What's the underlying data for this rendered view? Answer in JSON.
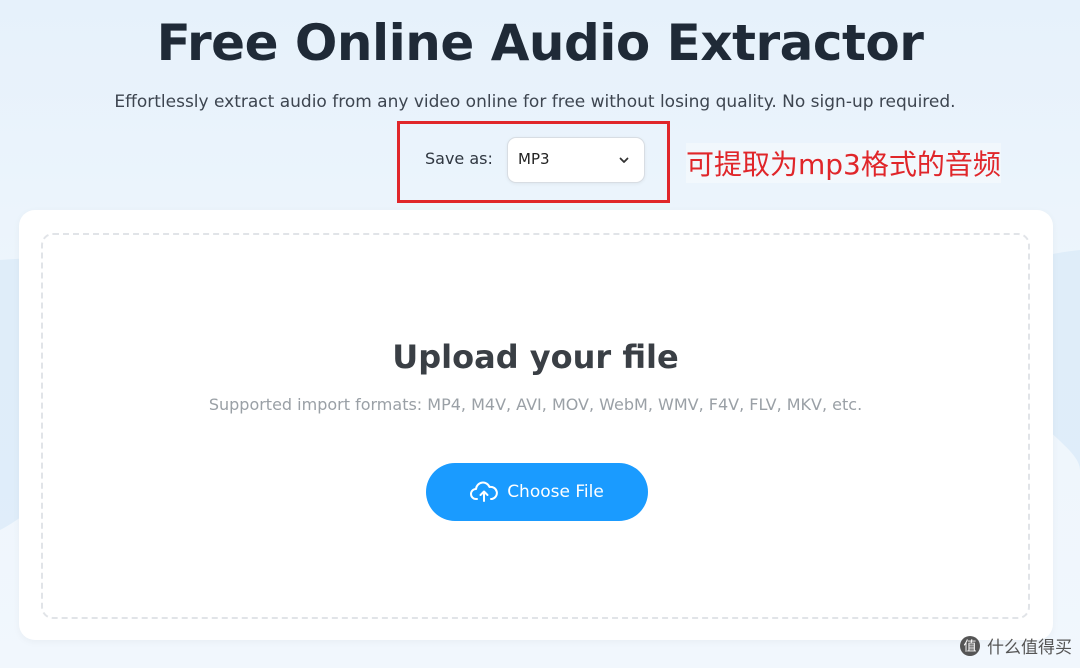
{
  "page": {
    "title": "Free Online Audio Extractor",
    "subtitle": "Effortlessly extract audio from any video online for free without losing quality. No sign-up required."
  },
  "save_as": {
    "label": "Save as:",
    "selected": "MP3"
  },
  "annotation": {
    "text": "可提取为mp3格式的音频",
    "color": "#e0262a"
  },
  "upload": {
    "title": "Upload your file",
    "formats": "Supported import formats: MP4, M4V, AVI, MOV, WebM, WMV, F4V, FLV, MKV, etc.",
    "button_label": "Choose File",
    "button_icon": "cloud-upload-icon"
  },
  "watermark": {
    "text": "什么值得买",
    "icon": "zhide-logo"
  },
  "colors": {
    "accent": "#1a9bff",
    "title": "#1f2a37",
    "highlight": "#e0262a"
  }
}
